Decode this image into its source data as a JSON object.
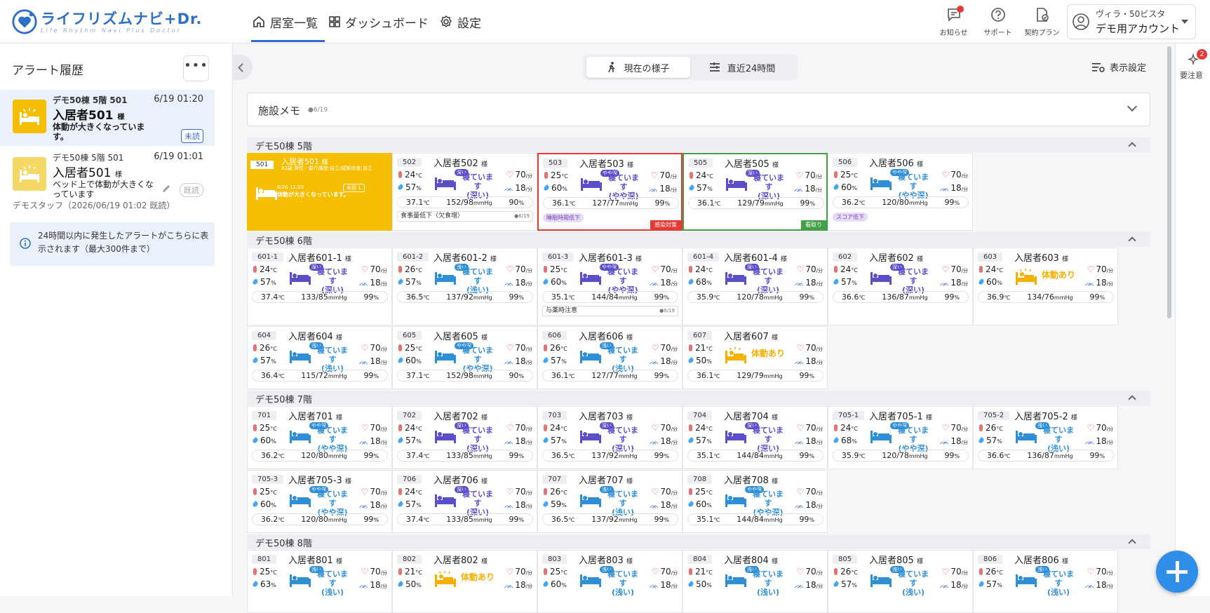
{
  "header": {
    "logo_text": "ライフリズムナビ+Dr.",
    "logo_sub": "Life Rhythm Navi Plus Doctor",
    "nav": [
      {
        "label": "居室一覧",
        "icon": "home-icon"
      },
      {
        "label": "ダッシュボード",
        "icon": "grid-icon"
      },
      {
        "label": "設定",
        "icon": "gear-icon"
      }
    ],
    "icons": [
      {
        "label": "お知らせ",
        "icon": "chat-bell-icon"
      },
      {
        "label": "サポート",
        "icon": "help-icon"
      },
      {
        "label": "契約プラン",
        "icon": "document-check-icon"
      }
    ],
    "account": {
      "facility": "ヴィラ・50ビスタ",
      "name": "デモ用アカウント"
    }
  },
  "sidebar": {
    "title": "アラート履歴",
    "more": "•••",
    "alerts": [
      {
        "facility": "デモ50棟 5階 501",
        "time": "6/19 01:20",
        "name": "入居者501",
        "suffix": "様",
        "message": "体動が大きくなっています。",
        "badge": "未読"
      },
      {
        "facility": "デモ50棟 5階 501",
        "time": "6/19 01:01",
        "name": "入居者501",
        "suffix": "様",
        "message": "ベッド上で体動が大きくなっています",
        "badge": "既読"
      }
    ],
    "staff_note": "デモスタッフ（2026/06/19 01:02 既読）",
    "info": "24時間以内に発生したアラートがこちらに表示されます（最大300件まで）"
  },
  "toolbar": {
    "now": "現在の様子",
    "last24": "直近24時間",
    "display": "表示設定"
  },
  "right_panel": {
    "label": "要注意",
    "badge": "2"
  },
  "memo": {
    "title": "施設メモ",
    "date": "●6/19"
  },
  "floors": [
    {
      "name": "デモ50棟 5階",
      "cards": [
        {
          "room": "501",
          "name": "入居者501",
          "type": "alert",
          "detail": "82歳 男性 · 要介護度:自立/認知症度:自立",
          "time": "6/20 11:03",
          "msg": "体動が大きくなっています。",
          "badge": "未読 1"
        },
        {
          "room": "502",
          "name": "入居者502",
          "temp": "24",
          "hum": "57",
          "st": "sleep",
          "status": "寝ています",
          "sub": "(深い)",
          "tag": "深い",
          "hr": "70",
          "rr": "18",
          "bt": "37.1",
          "bp": "152/98",
          "spo2": "90",
          "note": "食事量低下（欠食増）",
          "note_date": "●6/19"
        },
        {
          "room": "503",
          "name": "入居者503",
          "temp": "25",
          "hum": "60",
          "st": "sleep",
          "status": "寝ています",
          "sub": "(やや深)",
          "tag": "やや深",
          "hr": "70",
          "rr": "18",
          "bt": "36.1",
          "bp": "127/77",
          "spo2": "99",
          "ptag": "睡眠時間低下",
          "ctag": "感染対策",
          "ccolor": "red"
        },
        {
          "room": "505",
          "name": "入居者505",
          "temp": "24",
          "hum": "57",
          "st": "sleep",
          "status": "寝ています",
          "sub": "(深い)",
          "tag": "深い",
          "hr": "70",
          "rr": "18",
          "bt": "36.1",
          "bp": "129/79",
          "spo2": "99",
          "ctag": "看取り",
          "ccolor": "green"
        },
        {
          "room": "506",
          "name": "入居者506",
          "temp": "25",
          "hum": "60",
          "st": "light",
          "status": "寝ています",
          "sub": "(やや深)",
          "tag": "やや深",
          "hr": "70",
          "rr": "18",
          "bt": "36.2",
          "bp": "120/80",
          "spo2": "99",
          "ptag": "スコア低下"
        }
      ]
    },
    {
      "name": "デモ50棟 6階",
      "cards": [
        {
          "room": "601-1",
          "name": "入居者601-1",
          "temp": "24",
          "hum": "57",
          "st": "sleep",
          "status": "寝ています",
          "sub": "(深い)",
          "tag": "深い",
          "hr": "70",
          "rr": "18",
          "bt": "37.4",
          "bp": "133/85",
          "spo2": "99"
        },
        {
          "room": "601-2",
          "name": "入居者601-2",
          "temp": "26",
          "hum": "57",
          "st": "light",
          "status": "寝ています",
          "sub": "(浅い)",
          "tag": "浅い",
          "hr": "70",
          "rr": "18",
          "bt": "36.5",
          "bp": "137/92",
          "spo2": "99"
        },
        {
          "room": "601-3",
          "name": "入居者601-3",
          "temp": "25",
          "hum": "60",
          "st": "sleep",
          "status": "寝ています",
          "sub": "(やや深)",
          "tag": "やや深",
          "hr": "70",
          "rr": "18",
          "bt": "35.1",
          "bp": "144/84",
          "spo2": "99",
          "note": "与薬時注意",
          "note_date": "●6/19"
        },
        {
          "room": "601-4",
          "name": "入居者601-4",
          "temp": "24",
          "hum": "68",
          "st": "sleep",
          "status": "寝ています",
          "sub": "(深い)",
          "tag": "深い",
          "hr": "70",
          "rr": "18",
          "bt": "35.9",
          "bp": "120/78",
          "spo2": "99"
        },
        {
          "room": "602",
          "name": "入居者602",
          "temp": "24",
          "hum": "57",
          "st": "sleep",
          "status": "寝ています",
          "sub": "(深い)",
          "tag": "深い",
          "hr": "70",
          "rr": "18",
          "bt": "36.6",
          "bp": "136/87",
          "spo2": "99"
        },
        {
          "room": "603",
          "name": "入居者603",
          "temp": "24",
          "hum": "60",
          "st": "act",
          "status": "体動あり",
          "hr": "70",
          "rr": "18",
          "bt": "36.9",
          "bp": "134/76",
          "spo2": "99"
        },
        {
          "room": "604",
          "name": "入居者604",
          "temp": "26",
          "hum": "57",
          "st": "light",
          "status": "寝ています",
          "sub": "(浅い)",
          "tag": "浅い",
          "hr": "70",
          "rr": "18",
          "bt": "36.4",
          "bp": "115/72",
          "spo2": "99"
        },
        {
          "room": "605",
          "name": "入居者605",
          "temp": "25",
          "hum": "60",
          "st": "light",
          "status": "寝ています",
          "sub": "(やや深)",
          "tag": "やや深",
          "hr": "70",
          "rr": "18",
          "bt": "37.1",
          "bp": "152/98",
          "spo2": "90"
        },
        {
          "room": "606",
          "name": "入居者606",
          "temp": "26",
          "hum": "57",
          "st": "light",
          "status": "寝ています",
          "sub": "(浅い)",
          "tag": "浅い",
          "hr": "70",
          "rr": "18",
          "bt": "36.1",
          "bp": "127/77",
          "spo2": "99"
        },
        {
          "room": "607",
          "name": "入居者607",
          "temp": "21",
          "hum": "50",
          "st": "act",
          "status": "体動あり",
          "hr": "70",
          "rr": "18",
          "bt": "36.1",
          "bp": "129/79",
          "spo2": "99"
        }
      ]
    },
    {
      "name": "デモ50棟 7階",
      "cards": [
        {
          "room": "701",
          "name": "入居者701",
          "temp": "25",
          "hum": "60",
          "st": "light",
          "status": "寝ています",
          "sub": "(やや深)",
          "tag": "やや深",
          "hr": "70",
          "rr": "18",
          "bt": "36.2",
          "bp": "120/80",
          "spo2": "99"
        },
        {
          "room": "702",
          "name": "入居者702",
          "temp": "24",
          "hum": "57",
          "st": "sleep",
          "status": "寝ています",
          "sub": "(深い)",
          "tag": "深い",
          "hr": "70",
          "rr": "18",
          "bt": "37.4",
          "bp": "133/85",
          "spo2": "99"
        },
        {
          "room": "703",
          "name": "入居者703",
          "temp": "24",
          "hum": "57",
          "st": "sleep",
          "status": "寝ています",
          "sub": "(深い)",
          "tag": "深い",
          "hr": "70",
          "rr": "18",
          "bt": "36.5",
          "bp": "137/92",
          "spo2": "99"
        },
        {
          "room": "704",
          "name": "入居者704",
          "temp": "24",
          "hum": "57",
          "st": "sleep",
          "status": "寝ています",
          "sub": "(深い)",
          "tag": "深い",
          "hr": "70",
          "rr": "18",
          "bt": "35.1",
          "bp": "144/84",
          "spo2": "99"
        },
        {
          "room": "705-1",
          "name": "入居者705-1",
          "temp": "24",
          "hum": "68",
          "st": "light",
          "status": "寝ています",
          "sub": "(やや深)",
          "tag": "やや深",
          "hr": "70",
          "rr": "18",
          "bt": "35.9",
          "bp": "120/78",
          "spo2": "99"
        },
        {
          "room": "705-2",
          "name": "入居者705-2",
          "temp": "26",
          "hum": "57",
          "st": "light",
          "status": "寝ています",
          "sub": "(浅い)",
          "tag": "浅い",
          "hr": "70",
          "rr": "18",
          "bt": "36.6",
          "bp": "136/87",
          "spo2": "99"
        },
        {
          "room": "705-3",
          "name": "入居者705-3",
          "temp": "25",
          "hum": "60",
          "st": "light",
          "status": "寝ています",
          "sub": "(やや深)",
          "tag": "やや深",
          "hr": "70",
          "rr": "18",
          "bt": "36.2",
          "bp": "120/80",
          "spo2": "99"
        },
        {
          "room": "706",
          "name": "入居者706",
          "temp": "24",
          "hum": "57",
          "st": "sleep",
          "status": "寝ています",
          "sub": "(深い)",
          "tag": "深い",
          "hr": "70",
          "rr": "18",
          "bt": "37.4",
          "bp": "133/85",
          "spo2": "99"
        },
        {
          "room": "707",
          "name": "入居者707",
          "temp": "26",
          "hum": "59",
          "st": "light",
          "status": "寝ています",
          "sub": "(浅い)",
          "tag": "浅い",
          "hr": "70",
          "rr": "18",
          "bt": "36.5",
          "bp": "137/92",
          "spo2": "99"
        },
        {
          "room": "708",
          "name": "入居者708",
          "temp": "25",
          "hum": "60",
          "st": "light",
          "status": "寝ています",
          "sub": "(やや深)",
          "tag": "やや深",
          "hr": "70",
          "rr": "18",
          "bt": "35.1",
          "bp": "144/84",
          "spo2": "99"
        }
      ]
    },
    {
      "name": "デモ50棟 8階",
      "cards": [
        {
          "room": "801",
          "name": "入居者801",
          "temp": "25",
          "hum": "63",
          "st": "light",
          "status": "寝ています",
          "sub": "(浅い)",
          "tag": "浅い",
          "hr": "70",
          "rr": "18"
        },
        {
          "room": "802",
          "name": "入居者802",
          "temp": "21",
          "hum": "50",
          "st": "act",
          "status": "体動あり",
          "hr": "70",
          "rr": "18"
        },
        {
          "room": "803",
          "name": "入居者803",
          "temp": "25",
          "hum": "60",
          "st": "light",
          "status": "寝ています",
          "sub": "(浅い)",
          "tag": "浅い",
          "hr": "70",
          "rr": "18"
        },
        {
          "room": "804",
          "name": "入居者804",
          "temp": "21",
          "hum": "50",
          "st": "light",
          "status": "寝ています",
          "sub": "(浅い)",
          "tag": "浅い",
          "hr": "70",
          "rr": "18"
        },
        {
          "room": "805",
          "name": "入居者805",
          "temp": "26",
          "hum": "57",
          "st": "light",
          "status": "寝ています",
          "sub": "(浅い)",
          "tag": "浅い",
          "hr": "70",
          "rr": "18"
        },
        {
          "room": "806",
          "name": "入居者806",
          "temp": "26",
          "hum": "57",
          "st": "light",
          "status": "寝ています",
          "sub": "(浅い)",
          "tag": "浅い",
          "hr": "70",
          "rr": "18"
        }
      ]
    }
  ],
  "units": {
    "temp": "°C",
    "hum": "%",
    "hr": "/分",
    "rr": "/分",
    "bt": "℃",
    "bp": "mmHg",
    "spo2": "%",
    "sama": "様"
  }
}
